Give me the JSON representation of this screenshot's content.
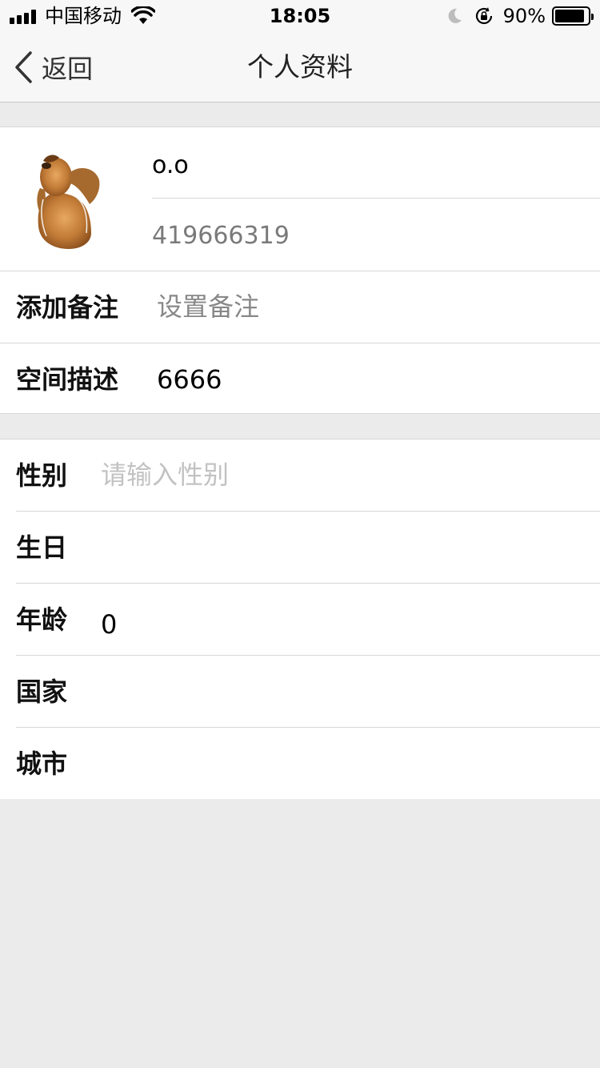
{
  "status_bar": {
    "carrier": "中国移动",
    "time": "18:05",
    "battery_percent": "90%",
    "battery_level": 0.9,
    "icons": [
      "signal-icon",
      "wifi-icon",
      "moon-icon",
      "rotation-lock-icon",
      "battery-icon"
    ]
  },
  "nav": {
    "back_label": "返回",
    "title": "个人资料"
  },
  "profile": {
    "name": "o.o",
    "id": "419666319"
  },
  "fields": {
    "note_label": "添加备注",
    "note_placeholder": "设置备注",
    "space_label": "空间描述",
    "space_value": "6666",
    "gender_label": "性别",
    "gender_placeholder": "请输入性别",
    "birthday_label": "生日",
    "age_label": "年龄",
    "age_value": "0",
    "country_label": "国家",
    "city_label": "城市"
  },
  "colors": {
    "nav_background": "#f7f7f7",
    "page_background": "#ebebeb",
    "placeholder": "#c2c2c2"
  }
}
